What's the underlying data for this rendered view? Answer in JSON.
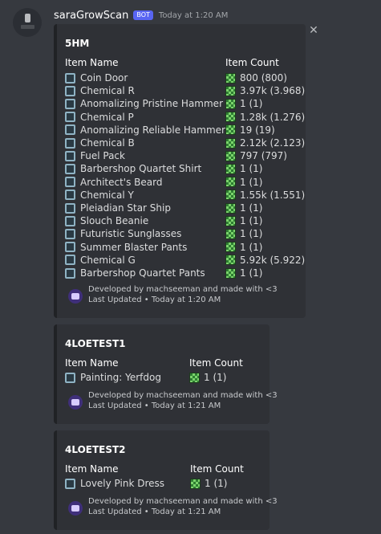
{
  "message": {
    "username": "saraGrowScan",
    "bot_badge": "BOT",
    "timestamp": "Today at 1:20 AM"
  },
  "embeds": [
    {
      "title": "5HM",
      "col_item": "Item Name",
      "col_count": "Item Count",
      "items": [
        {
          "name": "Coin Door",
          "count": "800 (800)"
        },
        {
          "name": "Chemical R",
          "count": "3.97k (3.968)"
        },
        {
          "name": "Anomalizing Pristine Hammer",
          "count": "1 (1)"
        },
        {
          "name": "Chemical P",
          "count": "1.28k (1.276)"
        },
        {
          "name": "Anomalizing Reliable Hammer",
          "count": "19 (19)"
        },
        {
          "name": "Chemical B",
          "count": "2.12k (2.123)"
        },
        {
          "name": "Fuel Pack",
          "count": "797 (797)"
        },
        {
          "name": "Barbershop Quartet Shirt",
          "count": "1 (1)"
        },
        {
          "name": "Architect's Beard",
          "count": "1 (1)"
        },
        {
          "name": "Chemical Y",
          "count": "1.55k (1.551)"
        },
        {
          "name": "Pleiadian Star Ship",
          "count": "1 (1)"
        },
        {
          "name": "Slouch Beanie",
          "count": "1 (1)"
        },
        {
          "name": "Futuristic Sunglasses",
          "count": "1 (1)"
        },
        {
          "name": "Summer Blaster Pants",
          "count": "1 (1)"
        },
        {
          "name": "Chemical G",
          "count": "5.92k (5.922)"
        },
        {
          "name": "Barbershop Quartet Pants",
          "count": "1 (1)"
        }
      ],
      "footer": "Developed by machseeman and made with <3",
      "updated": "Last Updated • Today at 1:20 AM"
    },
    {
      "title": "4LOETEST1",
      "col_item": "Item Name",
      "col_count": "Item Count",
      "items": [
        {
          "name": "Painting: Yerfdog",
          "count": "1 (1)"
        }
      ],
      "footer": "Developed by machseeman and made with <3",
      "updated": "Last Updated • Today at 1:21 AM"
    },
    {
      "title": "4LOETEST2",
      "col_item": "Item Name",
      "col_count": "Item Count",
      "items": [
        {
          "name": "Lovely Pink Dress",
          "count": "1 (1)"
        }
      ],
      "footer": "Developed by machseeman and made with <3",
      "updated": "Last Updated • Today at 1:21 AM"
    }
  ]
}
